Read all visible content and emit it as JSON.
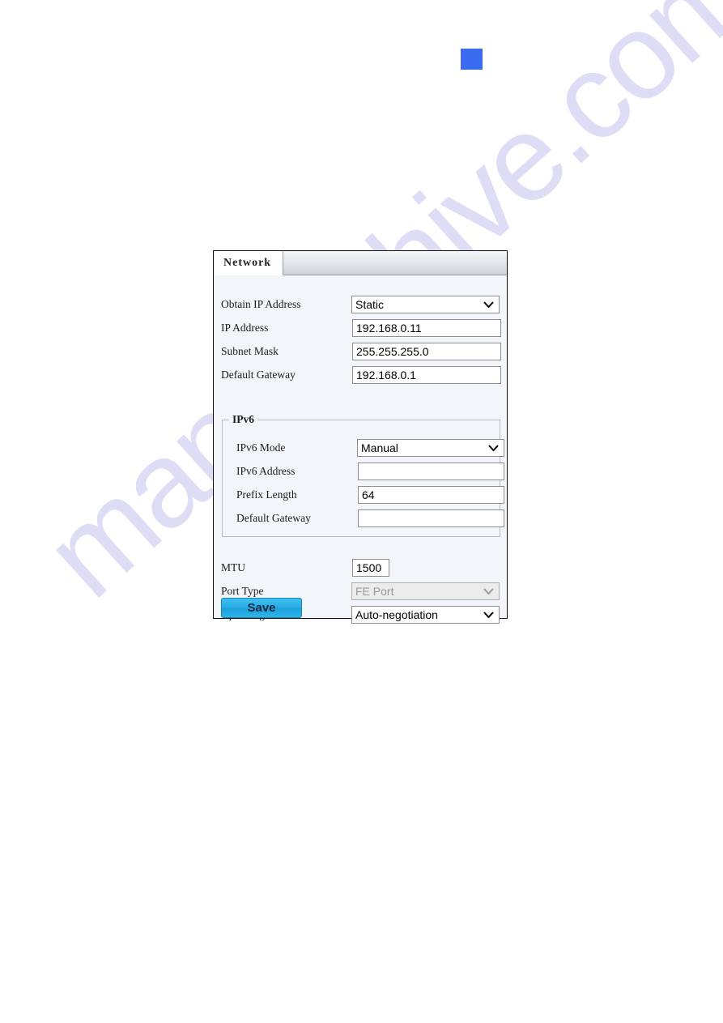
{
  "page": {
    "watermark_text": "manualshive.com",
    "accent_square_color": "#3a6bf0"
  },
  "panel": {
    "tab_label": "Network",
    "save_label": "Save",
    "fields": [
      {
        "label": "Obtain IP Address",
        "value": "Static",
        "type": "select"
      },
      {
        "label": "IP Address",
        "value": "192.168.0.11",
        "type": "text"
      },
      {
        "label": "Subnet Mask",
        "value": "255.255.255.0",
        "type": "text"
      },
      {
        "label": "Default Gateway",
        "value": "192.168.0.1",
        "type": "text"
      }
    ],
    "ipv6": {
      "legend": "IPv6",
      "fields": [
        {
          "label": "IPv6 Mode",
          "value": "Manual",
          "type": "select"
        },
        {
          "label": "IPv6 Address",
          "value": "",
          "type": "text"
        },
        {
          "label": "Prefix Length",
          "value": "64",
          "type": "text"
        },
        {
          "label": "Default Gateway",
          "value": "",
          "type": "text"
        }
      ]
    },
    "bottom_fields": [
      {
        "label": "MTU",
        "value": "1500",
        "type": "text"
      },
      {
        "label": "Port Type",
        "value": "FE Port",
        "type": "select",
        "disabled": true
      },
      {
        "label": "Operating Mode",
        "value": "Auto-negotiation",
        "type": "select"
      }
    ]
  }
}
